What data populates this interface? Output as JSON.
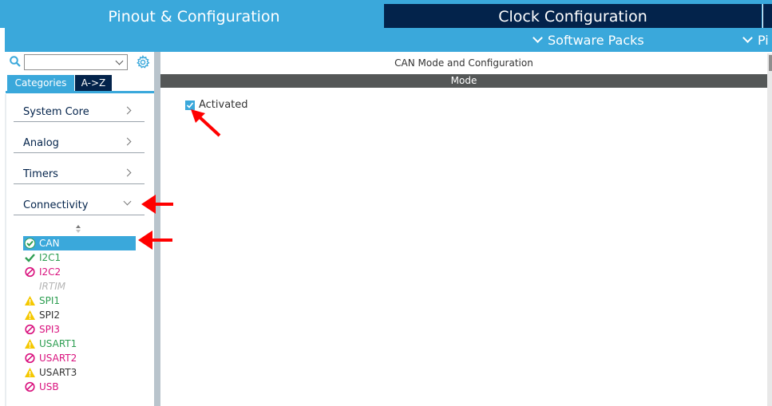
{
  "tabs": {
    "pinout": "Pinout & Configuration",
    "clock": "Clock Configuration"
  },
  "subbar": {
    "software_packs": "Software Packs",
    "pinout_truncated": "Pi"
  },
  "left_panel": {
    "search": {
      "value": "",
      "placeholder": ""
    },
    "tabs": {
      "categories": "Categories",
      "az": "A->Z"
    },
    "categories": [
      {
        "label": "System Core",
        "expanded": false
      },
      {
        "label": "Analog",
        "expanded": false
      },
      {
        "label": "Timers",
        "expanded": false
      },
      {
        "label": "Connectivity",
        "expanded": true
      }
    ],
    "peripherals": [
      {
        "label": "CAN",
        "status": "check-circle",
        "color": "#ffffff",
        "selected": true
      },
      {
        "label": "I2C1",
        "status": "check",
        "color": "#2e9e52",
        "selected": false
      },
      {
        "label": "I2C2",
        "status": "blocked",
        "color": "#d9127e",
        "selected": false
      },
      {
        "label": "IRTIM",
        "status": "none",
        "color": "#b5b5b5",
        "selected": false
      },
      {
        "label": "SPI1",
        "status": "warning",
        "color": "#2e9e52",
        "selected": false
      },
      {
        "label": "SPI2",
        "status": "warning",
        "color": "#333333",
        "selected": false
      },
      {
        "label": "SPI3",
        "status": "blocked",
        "color": "#d9127e",
        "selected": false
      },
      {
        "label": "USART1",
        "status": "warning",
        "color": "#2e9e52",
        "selected": false
      },
      {
        "label": "USART2",
        "status": "blocked",
        "color": "#d9127e",
        "selected": false
      },
      {
        "label": "USART3",
        "status": "warning",
        "color": "#333333",
        "selected": false
      },
      {
        "label": "USB",
        "status": "blocked",
        "color": "#d9127e",
        "selected": false
      }
    ]
  },
  "main": {
    "title": "CAN Mode and Configuration",
    "section": "Mode",
    "activated_label": "Activated",
    "activated_checked": true
  },
  "colors": {
    "accent": "#3aa8db",
    "navy": "#03234b",
    "ok": "#2e9e52",
    "blocked": "#d9127e",
    "warning": "#f5c800",
    "annotation": "#ff0000"
  }
}
